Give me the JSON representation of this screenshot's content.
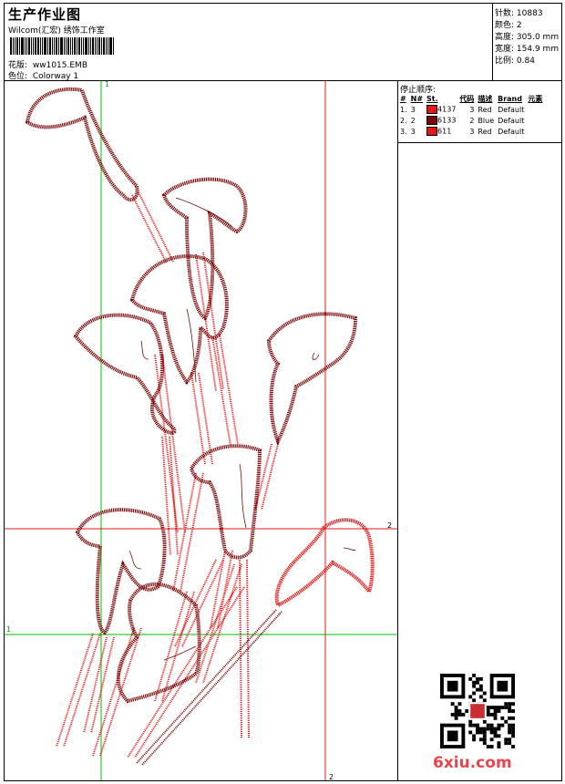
{
  "header": {
    "title": "生产作业图",
    "company": "Wilcom(汇宏) 绣饰工作室",
    "design_label": "花版:",
    "design_value": "ww1015.EMB",
    "colorway_label": "色位:",
    "colorway_value": "Colorway 1"
  },
  "stats": [
    {
      "label": "针数:",
      "value": "10883"
    },
    {
      "label": "颜色:",
      "value": "2"
    },
    {
      "label": "高度:",
      "value": "305.0 mm"
    },
    {
      "label": "宽度:",
      "value": "154.9 mm"
    },
    {
      "label": "比例:",
      "value": "0.84"
    }
  ],
  "sequence": {
    "title": "停止顺序:",
    "columns": [
      "#",
      "N#",
      "St.",
      "代码",
      "描述",
      "Brand",
      "元素"
    ],
    "rows": [
      {
        "index": "1.",
        "n": "3",
        "color": "#e01818",
        "stitches": "4137",
        "code": "3",
        "desc": "Red",
        "brand": "Default"
      },
      {
        "index": "2.",
        "n": "2",
        "color": "#7a0a0a",
        "stitches": "6133",
        "code": "2",
        "desc": "Blue",
        "brand": "Default"
      },
      {
        "index": "3.",
        "n": "3",
        "color": "#e01818",
        "stitches": "611",
        "code": "3",
        "desc": "Red",
        "brand": "Default"
      }
    ]
  },
  "guides": {
    "top_label": "1",
    "left_label": "1",
    "right_label": "2",
    "bottom_label": "2"
  },
  "watermark": "6xiu.com",
  "colors": {
    "stem_red": "#e01818",
    "flower_dark": "#7a0a0a",
    "guide_green": "#00c000",
    "guide_red": "#e01818"
  }
}
